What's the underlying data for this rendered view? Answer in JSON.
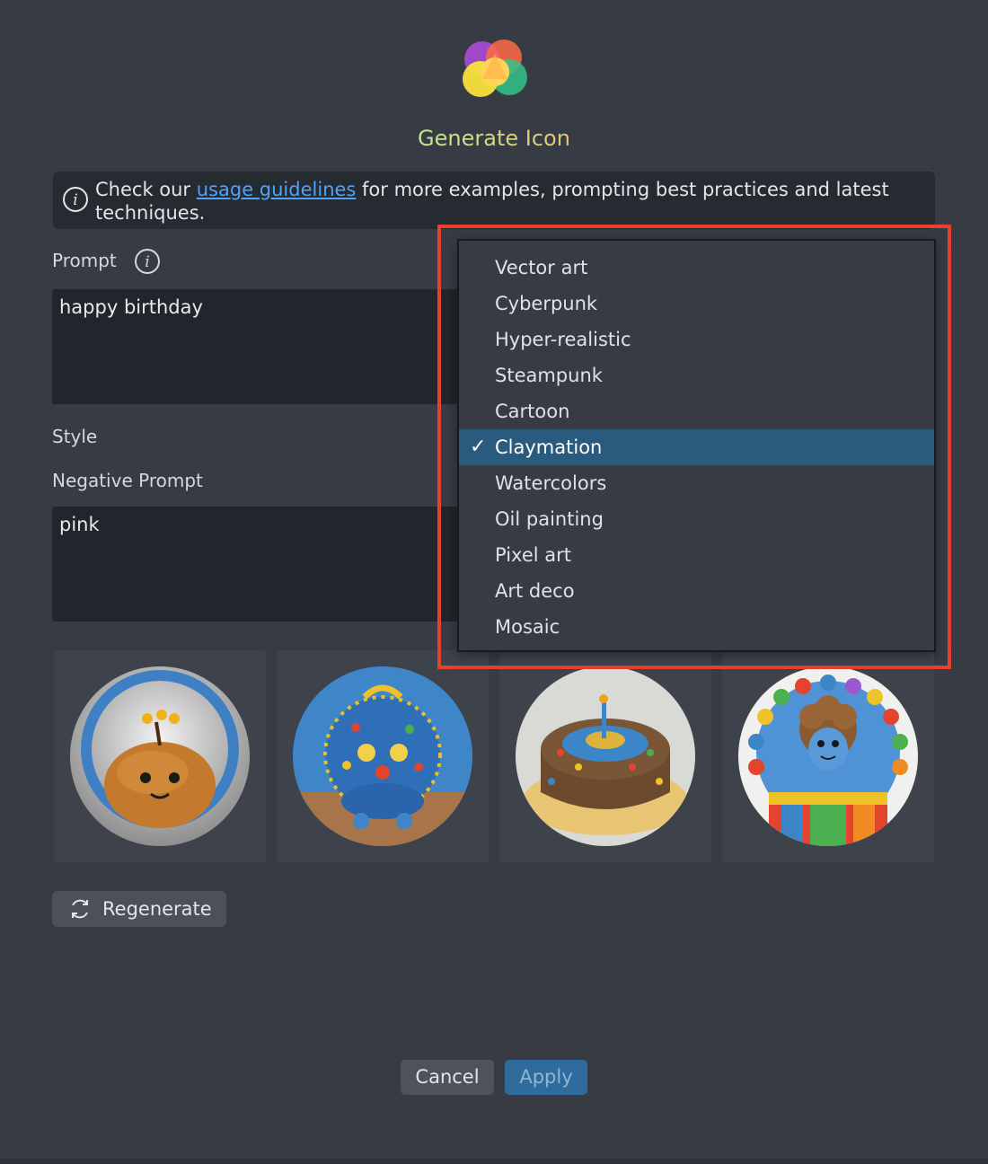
{
  "dialog": {
    "title": "Generate Icon",
    "notice": {
      "prefix": "Check our ",
      "link": "usage guidelines",
      "suffix": " for more examples, prompting best practices and latest techniques."
    },
    "prompt_label": "Prompt",
    "prompt_value": "happy birthday",
    "style_label": "Style",
    "negative_prompt_label": "Negative Prompt",
    "negative_prompt_value": "pink",
    "regenerate_label": "Regenerate",
    "cancel_label": "Cancel",
    "apply_label": "Apply"
  },
  "style_dropdown": {
    "selected": "Claymation",
    "check_glyph": "✓",
    "options": [
      "Vector art",
      "Cyberpunk",
      "Hyper-realistic",
      "Steampunk",
      "Cartoon",
      "Claymation",
      "Watercolors",
      "Oil painting",
      "Pixel art",
      "Art deco",
      "Mosaic"
    ]
  },
  "colors": {
    "background": "#373b43",
    "link": "#4da3ff",
    "highlight_border": "#e5412b",
    "selected_row": "#2a5a7e",
    "apply_button": "#2f6b9c"
  }
}
